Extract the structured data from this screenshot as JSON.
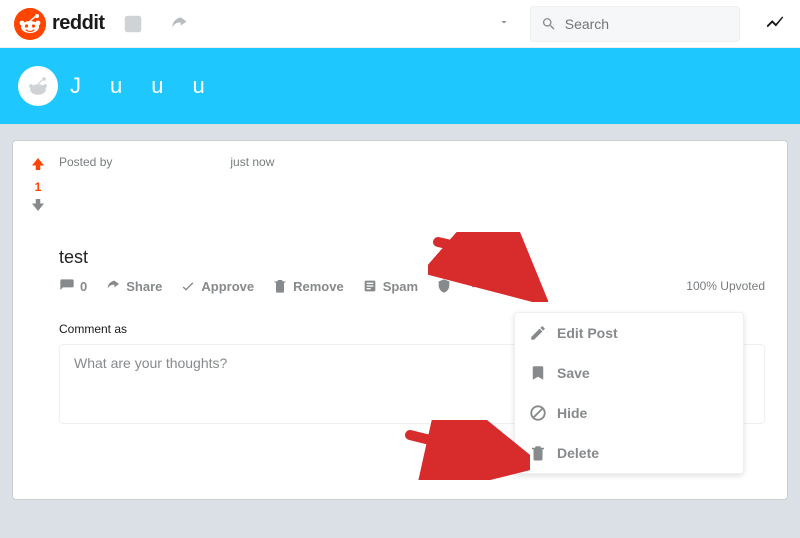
{
  "header": {
    "brand": "reddit",
    "search_placeholder": "Search"
  },
  "banner": {
    "fragments": [
      "J",
      "u",
      "u",
      "u"
    ]
  },
  "post": {
    "posted_by_prefix": "Posted by",
    "posted_time": "just now",
    "score": "1",
    "title": "test",
    "actions": {
      "comments": "0",
      "share": "Share",
      "approve": "Approve",
      "remove": "Remove",
      "spam": "Spam"
    },
    "upvoted_label": "100% Upvoted"
  },
  "comment": {
    "label": "Comment as",
    "placeholder": "What are your thoughts?"
  },
  "menu": {
    "edit": "Edit Post",
    "save": "Save",
    "hide": "Hide",
    "delete": "Delete"
  }
}
